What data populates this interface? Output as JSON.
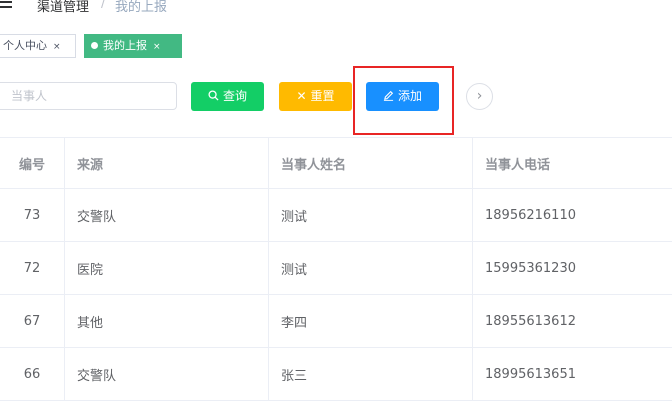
{
  "breadcrumb": {
    "items": [
      "渠道管理",
      "我的上报"
    ],
    "separator": "/"
  },
  "tabs": [
    {
      "label": "个人中心",
      "active": false,
      "close": "×"
    },
    {
      "label": "我的上报",
      "active": true,
      "close": "×"
    }
  ],
  "search": {
    "placeholder": "当事人",
    "value": ""
  },
  "toolbar": {
    "search_label": "查询",
    "reset_label": "重置",
    "add_label": "添加",
    "expand_icon": "›"
  },
  "colors": {
    "search": "#13ce66",
    "reset": "#ffba00",
    "add": "#1890ff",
    "active_tab": "#42b983",
    "highlight": "#e82525"
  },
  "table": {
    "headers": [
      "编号",
      "来源",
      "当事人姓名",
      "当事人电话"
    ],
    "rows": [
      [
        "73",
        "交警队",
        "测试",
        "18956216110"
      ],
      [
        "72",
        "医院",
        "测试",
        "15995361230"
      ],
      [
        "67",
        "其他",
        "李四",
        "18955613612"
      ],
      [
        "66",
        "交警队",
        "张三",
        "18995613651"
      ]
    ]
  }
}
